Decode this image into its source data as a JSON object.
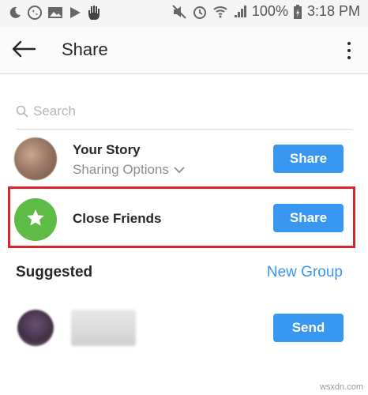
{
  "status_bar": {
    "battery": "100%",
    "time": "3:18 PM"
  },
  "header": {
    "title": "Share"
  },
  "search": {
    "placeholder": "Search"
  },
  "share_rows": [
    {
      "title": "Your Story",
      "subtitle": "Sharing Options",
      "button": "Share"
    },
    {
      "title": "Close Friends",
      "button": "Share"
    }
  ],
  "suggested": {
    "title": "Suggested",
    "new_group": "New Group",
    "items": [
      {
        "button": "Send"
      }
    ]
  },
  "watermark": "wsxdn.com",
  "colors": {
    "accent": "#3897f0",
    "close_friends": "#5dbb46",
    "highlight": "#d7262c"
  }
}
